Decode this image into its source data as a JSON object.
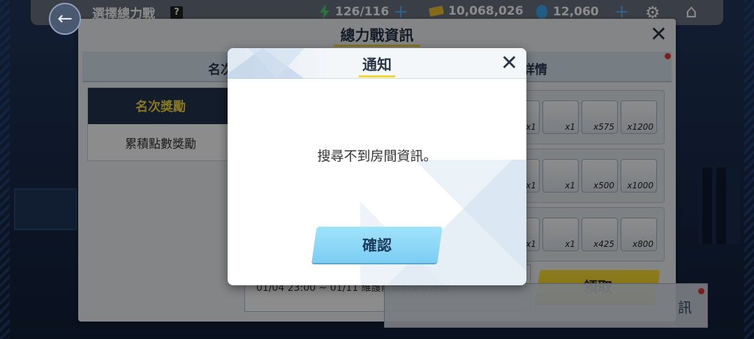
{
  "topbar": {
    "back_icon": "arrow-left-icon",
    "title": "選擇總力戰",
    "help": "?",
    "stamina": "126/116",
    "credits": "10,068,026",
    "gems": "12,060",
    "plus": "+",
    "gear_icon": "gear-icon",
    "home_icon": "home-icon"
  },
  "panel": {
    "title": "總力戰資訊",
    "close": "✕",
    "tabs": {
      "rank": "名次",
      "detail": "詳情"
    },
    "menu": {
      "active": "名次獎勵",
      "item": "累積點數獎勵"
    },
    "reward_rows": [
      {
        "items": [
          "x1",
          "x1",
          "x575",
          "x1200"
        ]
      },
      {
        "items": [
          "x1",
          "x1",
          "x500",
          "x1000"
        ]
      },
      {
        "items": [
          "x1",
          "x1",
          "x425",
          "x800"
        ]
      }
    ],
    "period_text": "01/04 23:00 ~ 01/11 維護前獎勵領取期間",
    "claim_label": "領取",
    "room_label": "訊"
  },
  "dialog": {
    "title": "通知",
    "close": "✕",
    "message": "搜尋不到房間資訊。",
    "confirm": "確認"
  },
  "colors": {
    "accent_yellow": "#f2d631",
    "confirm_blue": "#8fd9f8",
    "panel_dark": "#24344f"
  }
}
